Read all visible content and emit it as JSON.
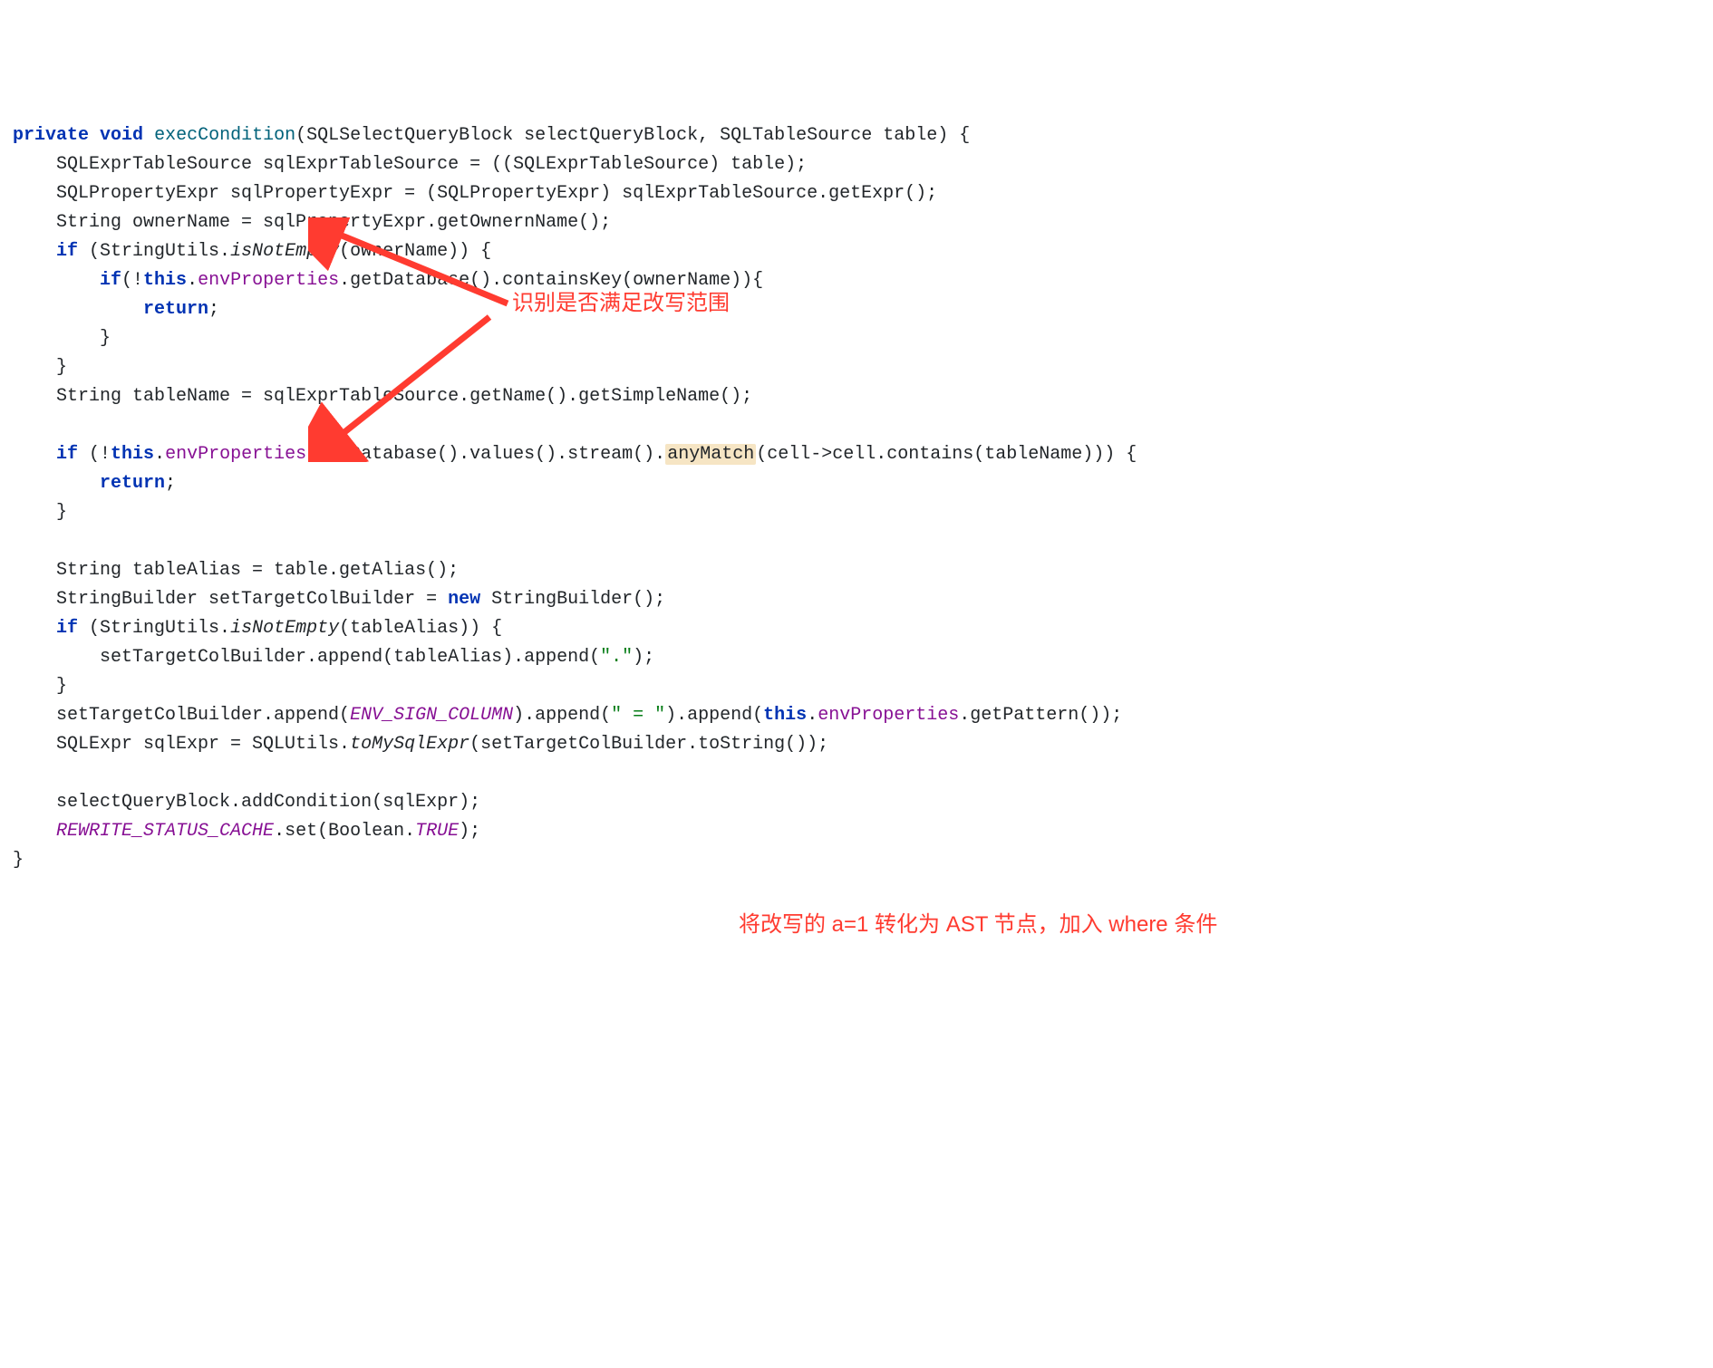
{
  "annotations": {
    "a1": "识别是否满足改写范围",
    "a2": "将改写的 a=1 转化为 AST 节点，加入 where 条件"
  },
  "code": {
    "kw_private": "private",
    "kw_void": "void",
    "m_execCondition": "execCondition",
    "sig_rest": "(SQLSelectQueryBlock selectQueryBlock, SQLTableSource table) {",
    "l2a": "    SQLExprTableSource sqlExprTableSource = ((SQLExprTableSource) table);",
    "l3a": "    SQLPropertyExpr sqlPropertyExpr = (SQLPropertyExpr) sqlExprTableSource.getExpr();",
    "l4a": "    String ownerName = sqlPropertyExpr.getOwnernName();",
    "kw_if": "if",
    "l5a": " (StringUtils.",
    "m_isNotEmpty": "isNotEmpty",
    "l5b": "(ownerName)) {",
    "l6a": "(!",
    "kw_this": "this",
    "dot": ".",
    "f_envProperties": "envProperties",
    "l6b": ".getDatabase().containsKey(ownerName)){",
    "kw_return": "return",
    "semi": ";",
    "cbrace": "}",
    "l10": "    String tableName = sqlExprTableSource.getName().getSimpleName();",
    "l12a": " (!",
    "l12b": ".getDatabase().values().stream().",
    "m_anyMatch": "anyMatch",
    "l12c": "(cell->cell.contains(tableName))) {",
    "l16": "    String tableAlias = table.getAlias();",
    "l17a": "    StringBuilder setTargetColBuilder = ",
    "kw_new": "new",
    "l17b": " StringBuilder();",
    "l18a": " (StringUtils.",
    "l18b": "(tableAlias)) {",
    "l19a": "        setTargetColBuilder.append(tableAlias).append(",
    "str_dot": "\".\"",
    "l19b": ");",
    "l21a": "    setTargetColBuilder.append(",
    "c_ENV_SIGN_COLUMN": "ENV_SIGN_COLUMN",
    "l21b": ").append(",
    "str_eq": "\" = \"",
    "l21c": ").append(",
    "l21d": ".getPattern());",
    "l22a": "    SQLExpr sqlExpr = SQLUtils.",
    "m_toMySqlExpr": "toMySqlExpr",
    "l22b": "(setTargetColBuilder.toString());",
    "l24": "    selectQueryBlock.addCondition(sqlExpr);",
    "c_REWRITE_STATUS_CACHE": "REWRITE_STATUS_CACHE",
    "l25a": ".set(Boolean.",
    "c_TRUE": "TRUE",
    "l25b": ");"
  }
}
